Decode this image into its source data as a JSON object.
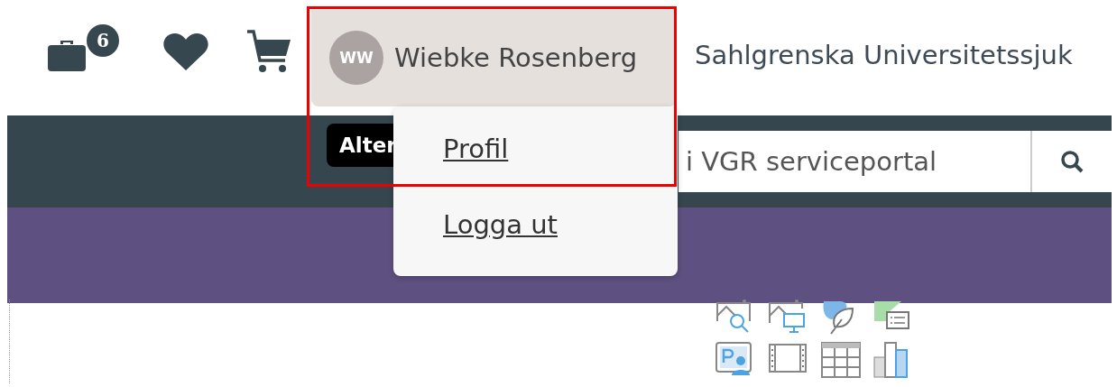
{
  "header": {
    "briefcase_badge": "6",
    "user": {
      "initials": "WW",
      "name": "Wiebke Rosenberg",
      "expanded": true
    },
    "organization": "Sahlgrenska Universitetssjuk"
  },
  "tooltip": "Alter",
  "user_menu": [
    {
      "label": "Profil"
    },
    {
      "label": "Logga ut"
    }
  ],
  "search": {
    "placeholder": "i VGR serviceportal"
  }
}
